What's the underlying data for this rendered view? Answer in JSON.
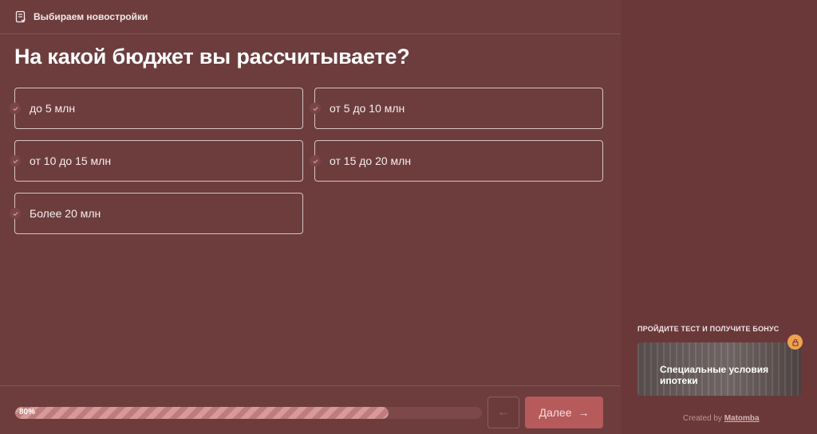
{
  "header": {
    "title": "Выбираем новостройки",
    "icon": "document-checklist-icon"
  },
  "question": "На какой бюджет вы рассчитываете?",
  "options": [
    {
      "label": "до 5 млн"
    },
    {
      "label": "от 5 до 10 млн"
    },
    {
      "label": "от 10 до 15 млн"
    },
    {
      "label": "от 15 до 20 млн"
    },
    {
      "label": "Более 20 млн"
    }
  ],
  "progress": {
    "value": 0.8,
    "label": "80%"
  },
  "nav": {
    "back_icon": "←",
    "next_label": "Далее",
    "next_icon": "→"
  },
  "sidebar": {
    "bonus_title": "ПРОЙДИТЕ ТЕСТ И ПОЛУЧИТЕ БОНУС",
    "bonus_card_label": "Специальные условия ипотеки",
    "lock_icon": "lock-icon",
    "created_prefix": "Created by",
    "created_brand": "Matomba"
  },
  "colors": {
    "background": "#6d3d3e",
    "accent": "#b75a5c",
    "progress_fill": "#d69a9b",
    "lock_badge": "#f0a24e"
  }
}
